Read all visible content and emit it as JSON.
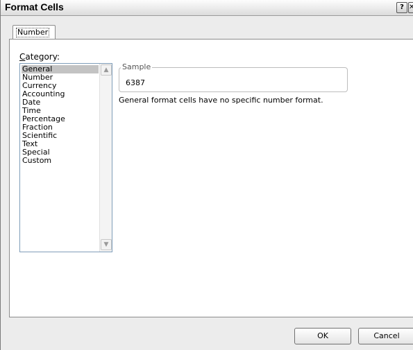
{
  "window": {
    "title": "Format Cells",
    "help_glyph": "?",
    "close_glyph": "✕"
  },
  "tabs": [
    {
      "label": "Number",
      "active": true
    }
  ],
  "category": {
    "label": "Category:",
    "items": [
      "General",
      "Number",
      "Currency",
      "Accounting",
      "Date",
      "Time",
      "Percentage",
      "Fraction",
      "Scientific",
      "Text",
      "Special",
      "Custom"
    ],
    "selected": "General",
    "scroll_up_glyph": "▲",
    "scroll_down_glyph": "▼"
  },
  "sample": {
    "legend": "Sample",
    "value": "6387"
  },
  "description": "General format cells have no specific number format.",
  "buttons": {
    "ok": "OK",
    "cancel": "Cancel"
  }
}
